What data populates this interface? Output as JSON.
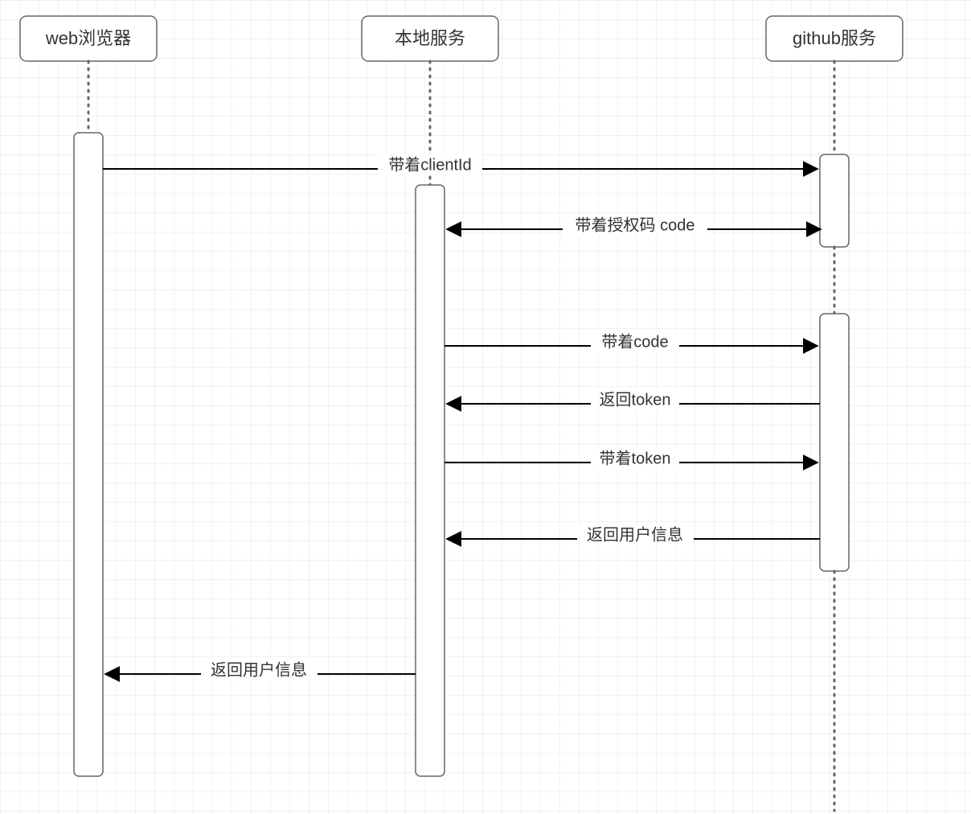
{
  "diagram": {
    "type": "sequence",
    "participants": [
      {
        "id": "web",
        "label": "web浏览器"
      },
      {
        "id": "local",
        "label": "本地服务"
      },
      {
        "id": "github",
        "label": "github服务"
      }
    ],
    "messages": [
      {
        "id": "m1",
        "from": "web",
        "to": "github",
        "label": "带着clientId"
      },
      {
        "id": "m2",
        "from": "github",
        "to": "local",
        "label": "带着授权码 code"
      },
      {
        "id": "m3",
        "from": "local",
        "to": "github",
        "label": "带着code"
      },
      {
        "id": "m4",
        "from": "github",
        "to": "local",
        "label": "返回token"
      },
      {
        "id": "m5",
        "from": "local",
        "to": "github",
        "label": "带着token"
      },
      {
        "id": "m6",
        "from": "github",
        "to": "local",
        "label": "返回用户信息"
      },
      {
        "id": "m7",
        "from": "local",
        "to": "web",
        "label": "返回用户信息"
      }
    ]
  }
}
